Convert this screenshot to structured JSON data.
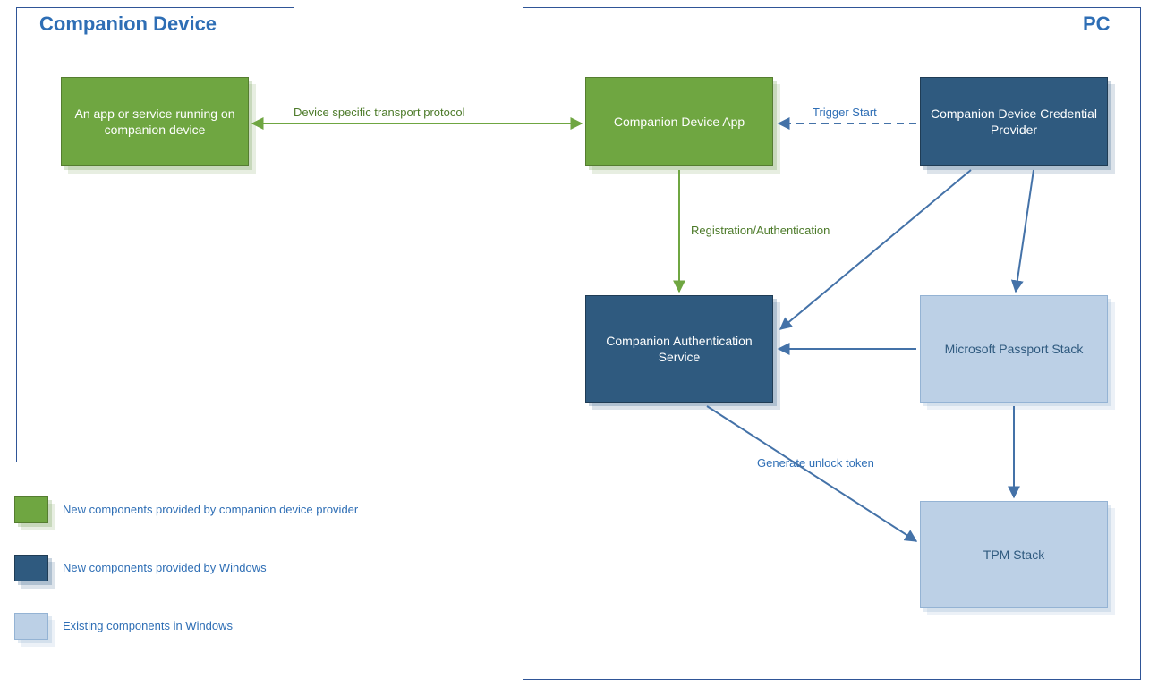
{
  "regions": {
    "companion": {
      "title": "Companion Device"
    },
    "pc": {
      "title": "PC"
    }
  },
  "nodes": {
    "appOnDevice": {
      "label": "An app or service running on companion device"
    },
    "companionApp": {
      "label": "Companion Device App"
    },
    "credProvider": {
      "label": "Companion Device Credential Provider"
    },
    "authService": {
      "label": "Companion Authentication Service"
    },
    "passportStack": {
      "label": "Microsoft Passport Stack"
    },
    "tpmStack": {
      "label": "TPM Stack"
    }
  },
  "edges": {
    "transport": {
      "label": "Device specific transport protocol"
    },
    "trigger": {
      "label": "Trigger Start"
    },
    "regAuth": {
      "label": "Registration/Authentication"
    },
    "generate": {
      "label": "Generate unlock token"
    }
  },
  "legend": {
    "green": "New components provided by companion device provider",
    "darkblue": "New components provided by Windows",
    "lightblue": "Existing components in Windows"
  },
  "colors": {
    "green": "#6fa641",
    "darkblue": "#2f5a7f",
    "lightblue": "#bcd0e6",
    "blueLine": "#4472a8",
    "greenLine": "#6fa641"
  }
}
